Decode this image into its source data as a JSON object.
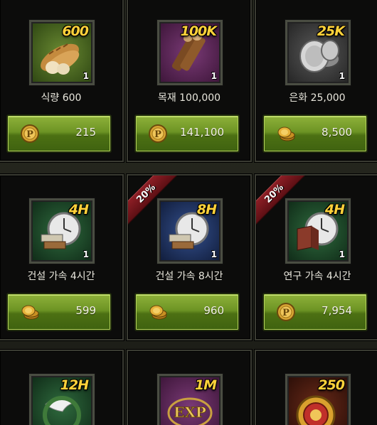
{
  "items": [
    {
      "amount_label": "600",
      "count": "1",
      "title": "식량 600",
      "price": "215",
      "currency_icon": "p-coin-icon",
      "ribbon": null,
      "icon": "bread-icon",
      "bg": "#3d5a1e"
    },
    {
      "amount_label": "100K",
      "count": "1",
      "title": "목재 100,000",
      "price": "141,100",
      "currency_icon": "p-coin-icon",
      "ribbon": null,
      "icon": "wood-logs-icon",
      "bg": "#5a2a55"
    },
    {
      "amount_label": "25K",
      "count": "1",
      "title": "은화 25,000",
      "price": "8,500",
      "currency_icon": "gold-coins-icon",
      "ribbon": null,
      "icon": "silver-coins-icon",
      "bg": "#3b3b3b"
    },
    {
      "amount_label": "4H",
      "count": "1",
      "title": "건설 가속 4시간",
      "price": "599",
      "currency_icon": "gold-coins-icon",
      "ribbon": null,
      "icon": "construction-speedup-icon",
      "bg": "#1f4a2e"
    },
    {
      "amount_label": "8H",
      "count": "1",
      "title": "건설 가속 8시간",
      "price": "960",
      "currency_icon": "gold-coins-icon",
      "ribbon": "20%",
      "icon": "construction-speedup-icon",
      "bg": "#1e2f58"
    },
    {
      "amount_label": "4H",
      "count": "1",
      "title": "연구 가속 4시간",
      "price": "7,954",
      "currency_icon": "p-coin-icon",
      "ribbon": "20%",
      "icon": "research-speedup-icon",
      "bg": "#1f4a2e"
    },
    {
      "amount_label": "12H",
      "count": "",
      "title": "",
      "price": "",
      "currency_icon": "",
      "ribbon": null,
      "icon": "dove-wreath-icon",
      "bg": "#1f4a2e"
    },
    {
      "amount_label": "1M",
      "count": "",
      "title": "",
      "price": "",
      "currency_icon": "",
      "ribbon": null,
      "icon": "exp-icon",
      "bg": "#5a2a55"
    },
    {
      "amount_label": "250",
      "count": "",
      "title": "",
      "price": "",
      "currency_icon": "",
      "ribbon": null,
      "icon": "gold-coin-stack-icon",
      "bg": "#3b1a12"
    }
  ]
}
